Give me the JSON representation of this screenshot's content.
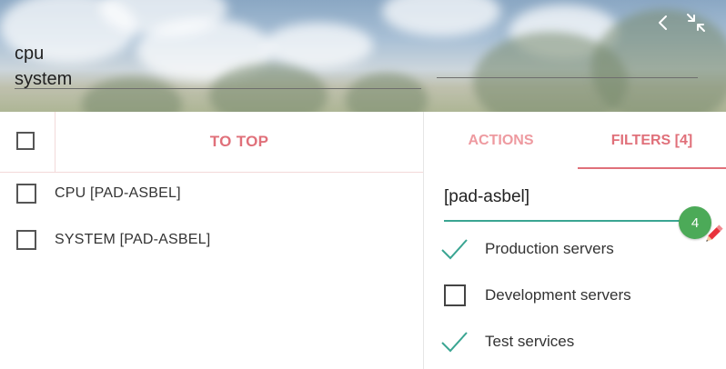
{
  "header": {
    "search_lines": [
      "cpu",
      "system"
    ],
    "icons": [
      "chevron-left-icon",
      "collapse-arrows-icon"
    ]
  },
  "left_toolbar": {
    "to_top_label": "TO TOP"
  },
  "list": {
    "items": [
      {
        "label": "CPU [PAD-ASBEL]",
        "checked": false
      },
      {
        "label": "SYSTEM [PAD-ASBEL]",
        "checked": false
      }
    ]
  },
  "tabs": {
    "items": [
      {
        "label": "ACTIONS",
        "active": false
      },
      {
        "label": "FILTERS [4]",
        "active": true
      }
    ]
  },
  "filters": {
    "input_value": "[pad-asbel]",
    "badge_count": "4",
    "options": [
      {
        "label": "Production servers",
        "checked": true
      },
      {
        "label": "Development servers",
        "checked": false
      },
      {
        "label": "Test services",
        "checked": true
      }
    ]
  },
  "colors": {
    "accent": "#e0707a",
    "accent_light": "#ee9aa0",
    "teal": "#3aa592",
    "badge_green": "#4caa58"
  }
}
